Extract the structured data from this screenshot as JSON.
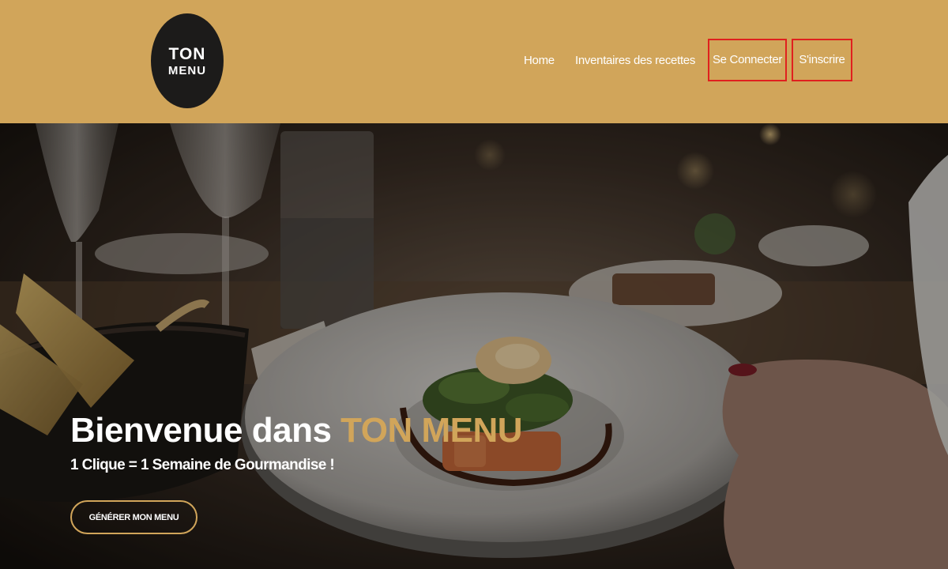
{
  "logo": {
    "line1": "TON",
    "line2": "MENU"
  },
  "nav": {
    "home": "Home",
    "inventory": "Inventaires des recettes",
    "login": "Se Connecter",
    "signup": "S'inscrire"
  },
  "hero": {
    "title_prefix": "Bienvenue dans ",
    "title_accent": "TON MENU",
    "subtitle": "1 Clique = 1 Semaine de Gourmandise !",
    "cta_label": "GÉNÉRER MON MENU"
  },
  "colors": {
    "header_bg": "#d1a55a",
    "accent": "#d1a55a",
    "highlight_border": "#e0201e",
    "logo_bg": "#1c1b1a"
  }
}
